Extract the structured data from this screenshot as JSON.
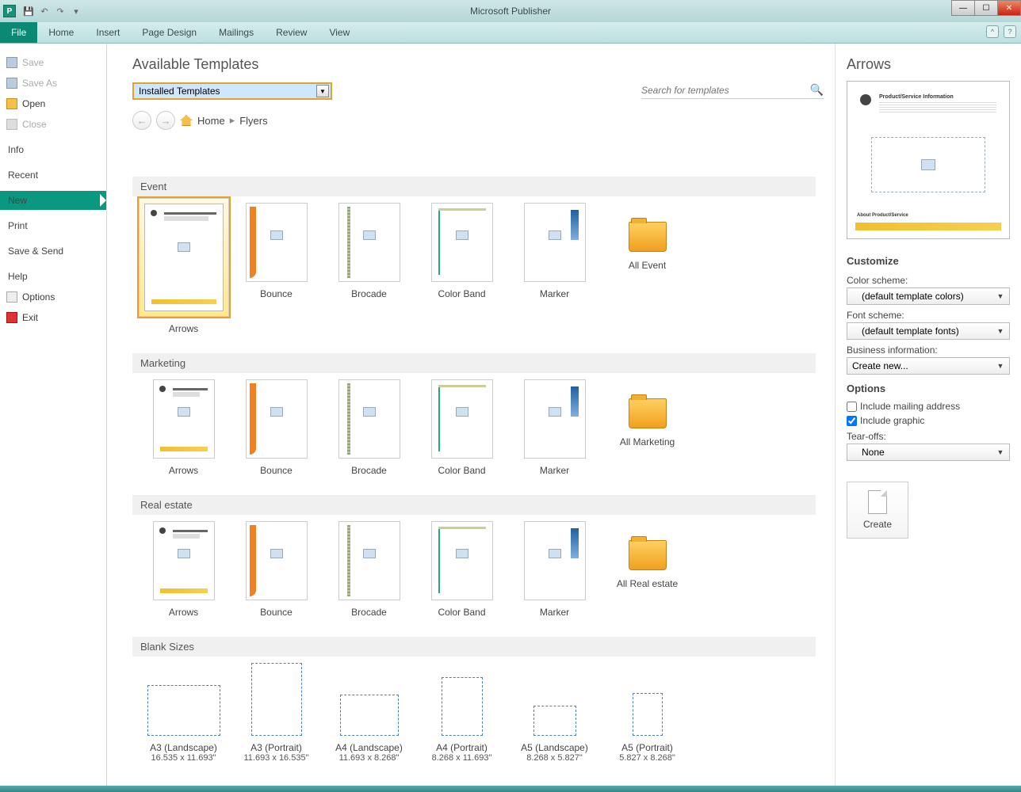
{
  "app": {
    "title": "Microsoft Publisher"
  },
  "ribbon": {
    "file": "File",
    "tabs": [
      "Home",
      "Insert",
      "Page Design",
      "Mailings",
      "Review",
      "View"
    ]
  },
  "sidebar": {
    "save": "Save",
    "saveas": "Save As",
    "open": "Open",
    "close": "Close",
    "info": "Info",
    "recent": "Recent",
    "new": "New",
    "print": "Print",
    "savesend": "Save & Send",
    "help": "Help",
    "options": "Options",
    "exit": "Exit"
  },
  "main": {
    "heading": "Available Templates",
    "combo": "Installed Templates",
    "search_placeholder": "Search for templates",
    "breadcrumb": {
      "home": "Home",
      "cur": "Flyers"
    }
  },
  "sections": {
    "event": {
      "title": "Event",
      "all": "All Event"
    },
    "marketing": {
      "title": "Marketing",
      "all": "All Marketing"
    },
    "realestate": {
      "title": "Real estate",
      "all": "All Real estate"
    },
    "blank": {
      "title": "Blank Sizes"
    },
    "items": {
      "arrows": "Arrows",
      "bounce": "Bounce",
      "brocade": "Brocade",
      "colorband": "Color Band",
      "marker": "Marker"
    }
  },
  "blank": [
    {
      "name": "A3 (Landscape)",
      "dim": "16.535 x 11.693\""
    },
    {
      "name": "A3 (Portrait)",
      "dim": "11.693 x 16.535\""
    },
    {
      "name": "A4 (Landscape)",
      "dim": "11.693 x 8.268\""
    },
    {
      "name": "A4 (Portrait)",
      "dim": "8.268 x 11.693\""
    },
    {
      "name": "A5 (Landscape)",
      "dim": "8.268 x 5.827\""
    },
    {
      "name": "A5 (Portrait)",
      "dim": "5.827 x 8.268\""
    }
  ],
  "right": {
    "title": "Arrows",
    "preview_headline": "Product/Service Information",
    "preview_footer": "About\nProduct/Service",
    "customize": "Customize",
    "color_l": "Color scheme:",
    "color_v": "(default template colors)",
    "font_l": "Font scheme:",
    "font_v": "(default template fonts)",
    "biz_l": "Business information:",
    "biz_v": "Create new...",
    "options": "Options",
    "mail": "Include mailing address",
    "graphic": "Include graphic",
    "tear_l": "Tear-offs:",
    "tear_v": "None",
    "create": "Create"
  }
}
